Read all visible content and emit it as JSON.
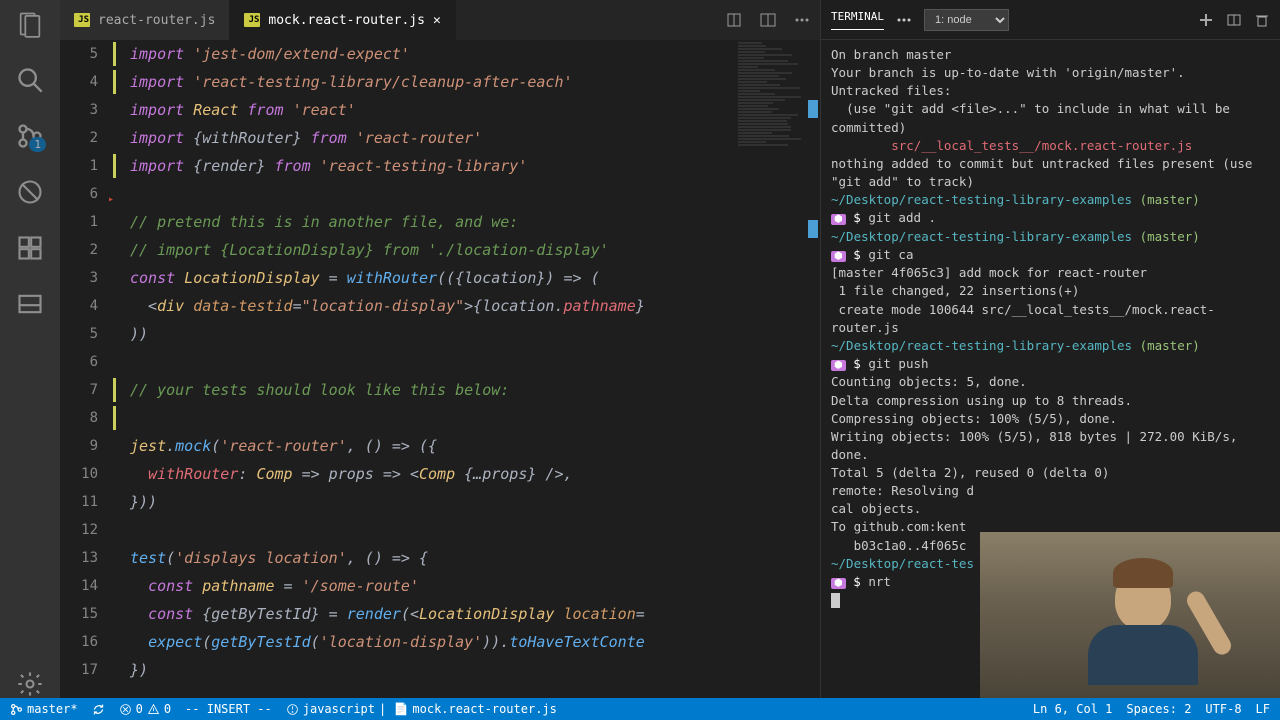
{
  "tabs": [
    {
      "label": "react-router.js"
    },
    {
      "label": "mock.react-router.js"
    }
  ],
  "gutter": [
    "5",
    "4",
    "3",
    "2",
    "1",
    "6",
    "1",
    "2",
    "3",
    "4",
    "5",
    "6",
    "7",
    "8",
    "9",
    "10",
    "11",
    "12",
    "13",
    "14",
    "15",
    "16",
    "17"
  ],
  "code": {
    "l1": "import ",
    "s1": "'jest-dom/extend-expect'",
    "l2": "import ",
    "s2": "'react-testing-library/cleanup-after-each'",
    "l3a": "import ",
    "l3b": "React ",
    "l3c": "from ",
    "s3": "'react'",
    "l4a": "import ",
    "l4b": "{withRouter} ",
    "l4c": "from ",
    "s4": "'react-router'",
    "l5a": "import ",
    "l5b": "{render} ",
    "l5c": "from ",
    "s5": "'react-testing-library'",
    "c7": "// pretend this is in another file, and we:",
    "c8": "// import {LocationDisplay} from './location-display'",
    "l9a": "const ",
    "l9b": "LocationDisplay",
    "l9c": " = ",
    "l9d": "withRouter",
    "l9e": "(({location}) => (",
    "l10": "  <div data-testid=\"location-display\">{location.pathname}",
    "l11": "))",
    "c13": "// your tests should look like this below:",
    "l15": "jest.mock('react-router', () => ({",
    "l16": "  withRouter: Comp => props => <Comp {…props} />,",
    "l17": "}))",
    "l19": "test('displays location', () => {",
    "l20": "  const pathname = '/some-route'",
    "l21": "  const {getByTestId} = render(<LocationDisplay location=",
    "l22": "  expect(getByTestId('location-display')).toHaveTextConte",
    "l23": "})"
  },
  "terminal": {
    "tab": "TERMINAL",
    "select": "1: node",
    "lines": [
      {
        "t": "On branch master",
        "c": ""
      },
      {
        "t": "Your branch is up-to-date with 'origin/master'.",
        "c": ""
      },
      {
        "t": "",
        "c": ""
      },
      {
        "t": "Untracked files:",
        "c": ""
      },
      {
        "t": "  (use \"git add <file>...\" to include in what will be committed)",
        "c": ""
      },
      {
        "t": "",
        "c": ""
      },
      {
        "t": "        src/__local_tests__/mock.react-router.js",
        "c": "t-red"
      },
      {
        "t": "",
        "c": ""
      },
      {
        "t": "nothing added to commit but untracked files present (use \"git add\" to track)",
        "c": ""
      },
      {
        "prompt": "~/Desktop/react-testing-library-examples",
        "branch": "(master)",
        "cmd": "git add ."
      },
      {
        "prompt": "~/Desktop/react-testing-library-examples",
        "branch": "(master)",
        "cmd": "git ca"
      },
      {
        "t": "[master 4f065c3] add mock for react-router",
        "c": ""
      },
      {
        "t": " 1 file changed, 22 insertions(+)",
        "c": ""
      },
      {
        "t": " create mode 100644 src/__local_tests__/mock.react-router.js",
        "c": ""
      },
      {
        "prompt": "~/Desktop/react-testing-library-examples",
        "branch": "(master)",
        "cmd": "git push"
      },
      {
        "t": "Counting objects: 5, done.",
        "c": ""
      },
      {
        "t": "Delta compression using up to 8 threads.",
        "c": ""
      },
      {
        "t": "Compressing objects: 100% (5/5), done.",
        "c": ""
      },
      {
        "t": "Writing objects: 100% (5/5), 818 bytes | 272.00 KiB/s, done.",
        "c": ""
      },
      {
        "t": "Total 5 (delta 2), reused 0 (delta 0)",
        "c": ""
      },
      {
        "t": "remote: Resolving d",
        "c": ""
      },
      {
        "t": "cal objects.",
        "c": ""
      },
      {
        "t": "To github.com:kent",
        "c": ""
      },
      {
        "t": "   b03c1a0..4f065c",
        "c": ""
      },
      {
        "prompt": "~/Desktop/react-tes",
        "branch": "",
        "cmd": "nrt"
      },
      {
        "cursor": true
      }
    ]
  },
  "status": {
    "branch": "master*",
    "errors": "0",
    "warnings": "0",
    "mode": "-- INSERT --",
    "lang_icon": "javascript",
    "filepath": "mock.react-router.js",
    "pos": "Ln 6, Col 1",
    "spaces": "Spaces: 2",
    "encoding": "UTF-8",
    "eol": "LF"
  },
  "scm_badge": "1"
}
